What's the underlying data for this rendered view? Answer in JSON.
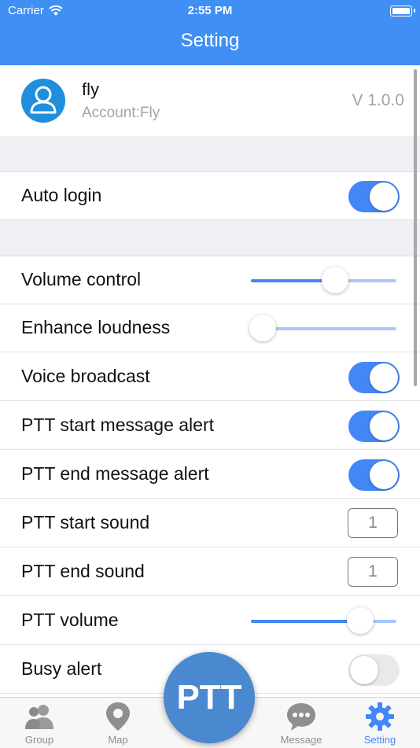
{
  "status_bar": {
    "carrier": "Carrier",
    "time": "2:55 PM"
  },
  "nav": {
    "title": "Setting"
  },
  "profile": {
    "name": "fly",
    "account": "Account:Fly",
    "version": "V 1.0.0",
    "avatar_icon": "person-icon"
  },
  "settings": {
    "auto_login": {
      "label": "Auto login",
      "on": true
    },
    "volume_control": {
      "label": "Volume control",
      "level": 0.58
    },
    "enhance_loudness": {
      "label": "Enhance loudness",
      "level": 0.08
    },
    "voice_broadcast": {
      "label": "Voice broadcast",
      "on": true
    },
    "ptt_start_alert": {
      "label": "PTT start message alert",
      "on": true
    },
    "ptt_end_alert": {
      "label": "PTT end message alert",
      "on": true
    },
    "ptt_start_sound": {
      "label": "PTT start sound",
      "value": "1"
    },
    "ptt_end_sound": {
      "label": "PTT end sound",
      "value": "1"
    },
    "ptt_volume": {
      "label": "PTT volume",
      "level": 0.75
    },
    "busy_alert": {
      "label": "Busy alert",
      "on": false
    }
  },
  "tabs": [
    {
      "label": "Group",
      "icon": "group-icon"
    },
    {
      "label": "Map",
      "icon": "map-pin-icon"
    },
    {
      "label": "Message",
      "icon": "chat-bubble-icon"
    },
    {
      "label": "Setting",
      "icon": "gear-icon",
      "active": true
    }
  ],
  "ptt_button": {
    "label": "PTT"
  },
  "colors": {
    "accent": "#4287f5",
    "header": "#3f8ff4",
    "ptt": "#4a88cf"
  }
}
